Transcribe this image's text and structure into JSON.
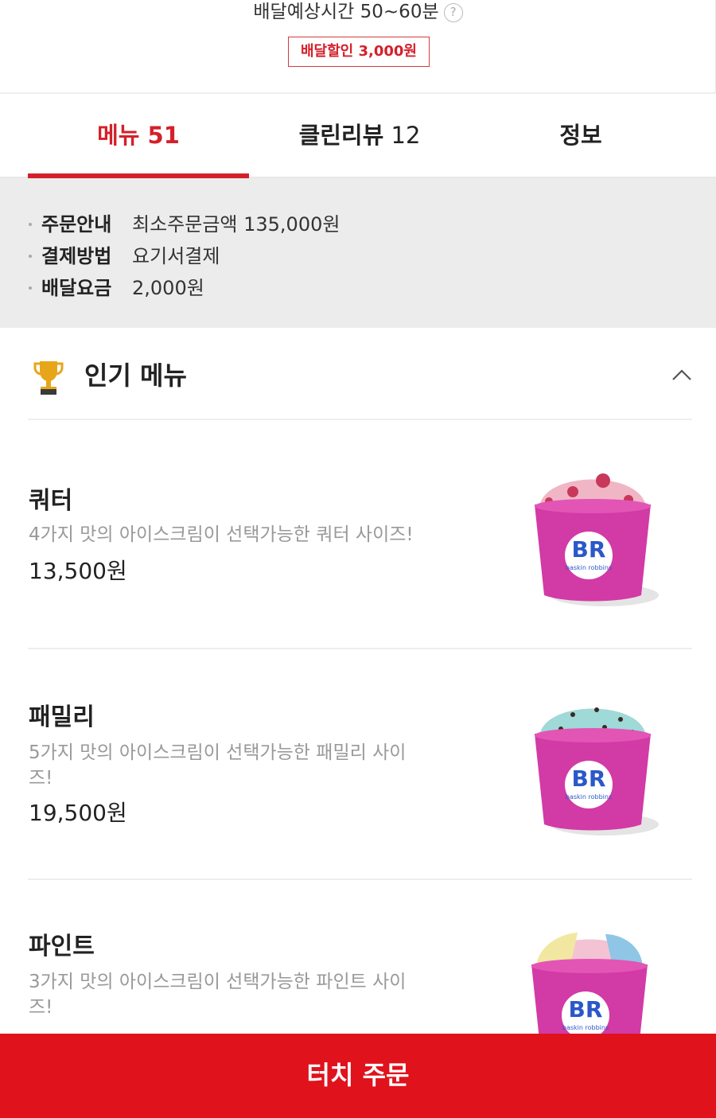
{
  "header": {
    "eta_text": "배달예상시간 50~60분",
    "help_icon": "question-icon",
    "help_symbol": "?",
    "discount_badge": "배달할인 3,000원"
  },
  "tabs": [
    {
      "label": "메뉴 51",
      "active": true
    },
    {
      "label_main": "클린리뷰",
      "label_count": "12",
      "active": false
    },
    {
      "label": "정보",
      "active": false
    }
  ],
  "info": {
    "rows": [
      {
        "key": "주문안내",
        "value": "최소주문금액 135,000원"
      },
      {
        "key": "결제방법",
        "value": "요기서결제"
      },
      {
        "key": "배달요금",
        "value": "2,000원"
      }
    ]
  },
  "section": {
    "icon": "trophy-icon",
    "title": "인기 메뉴",
    "collapse_icon": "chevron-up-icon"
  },
  "menu_items": [
    {
      "name": "쿼터",
      "desc": "4가지 맛의 아이스크림이 선택가능한 쿼터 사이즈!",
      "price": "13,500원",
      "scoop_color": "#f1b6c6"
    },
    {
      "name": "패밀리",
      "desc": "5가지 맛의 아이스크림이 선택가능한 패밀리 사이즈!",
      "price": "19,500원",
      "scoop_color": "#9fd9d8"
    },
    {
      "name": "파인트",
      "desc": "3가지 맛의 아이스크림이 선택가능한 파인트 사이즈!",
      "scoop_color": "#f3c3d3"
    }
  ],
  "cup_logo": {
    "letters": "BR",
    "words": "baskin robbins"
  },
  "order_button": {
    "label": "터치 주문"
  },
  "colors": {
    "accent": "#d4202a",
    "button": "#e0121c",
    "cup": "#d23aa6"
  }
}
